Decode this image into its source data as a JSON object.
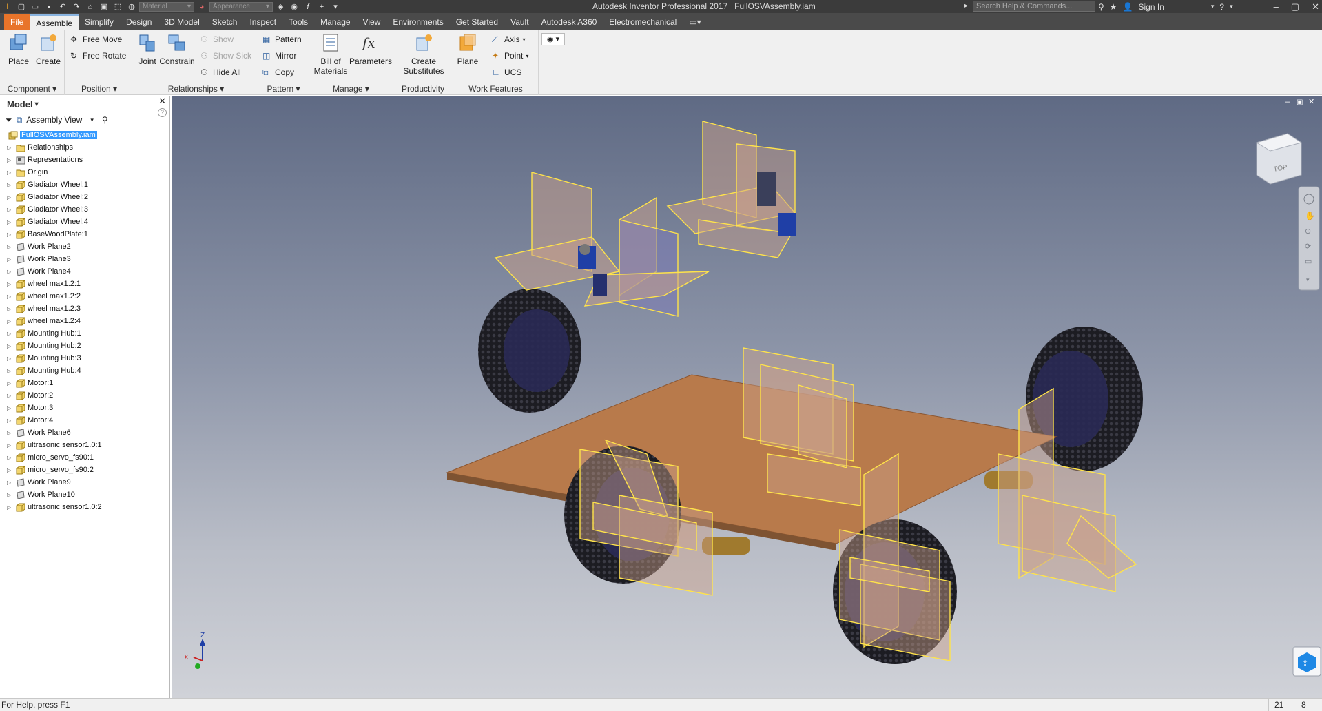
{
  "titlebar": {
    "app_title": "Autodesk Inventor Professional 2017",
    "file_title": "FullOSVAssembly.iam",
    "material_placeholder": "Material",
    "appearance_placeholder": "Appearance",
    "search_placeholder": "Search Help & Commands...",
    "sign_in": "Sign In"
  },
  "tabs": [
    "File",
    "Assemble",
    "Simplify",
    "Design",
    "3D Model",
    "Sketch",
    "Inspect",
    "Tools",
    "Manage",
    "View",
    "Environments",
    "Get Started",
    "Vault",
    "Autodesk A360",
    "Electromechanical"
  ],
  "ribbon": {
    "component": {
      "label": "Component",
      "place": "Place",
      "create": "Create"
    },
    "position": {
      "label": "Position",
      "free_move": "Free Move",
      "free_rotate": "Free Rotate"
    },
    "relationships": {
      "label": "Relationships",
      "joint": "Joint",
      "constrain": "Constrain",
      "show": "Show",
      "show_sick": "Show Sick",
      "hide_all": "Hide All"
    },
    "pattern": {
      "label": "Pattern",
      "pattern": "Pattern",
      "mirror": "Mirror",
      "copy": "Copy"
    },
    "manage": {
      "label": "Manage",
      "bom_line1": "Bill of",
      "bom_line2": "Materials",
      "parameters": "Parameters"
    },
    "productivity": {
      "label": "Productivity",
      "line1": "Create",
      "line2": "Substitutes"
    },
    "work_features": {
      "label": "Work Features",
      "plane": "Plane",
      "axis": "Axis",
      "point": "Point",
      "ucs": "UCS"
    }
  },
  "browser": {
    "title": "Model",
    "view": "Assembly View",
    "root": "FullOSVAssembly.iam",
    "items": [
      {
        "label": "Relationships",
        "icon": "folder-icon"
      },
      {
        "label": "Representations",
        "icon": "representations-icon"
      },
      {
        "label": "Origin",
        "icon": "folder-icon"
      },
      {
        "label": "Gladiator Wheel:1",
        "icon": "part-icon"
      },
      {
        "label": "Gladiator Wheel:2",
        "icon": "part-icon"
      },
      {
        "label": "Gladiator Wheel:3",
        "icon": "part-icon"
      },
      {
        "label": "Gladiator Wheel:4",
        "icon": "part-icon"
      },
      {
        "label": "BaseWoodPlate:1",
        "icon": "part-icon"
      },
      {
        "label": "Work Plane2",
        "icon": "work-plane-icon"
      },
      {
        "label": "Work Plane3",
        "icon": "work-plane-icon"
      },
      {
        "label": "Work Plane4",
        "icon": "work-plane-icon"
      },
      {
        "label": "wheel max1.2:1",
        "icon": "part-icon"
      },
      {
        "label": "wheel max1.2:2",
        "icon": "part-icon"
      },
      {
        "label": "wheel max1.2:3",
        "icon": "part-icon"
      },
      {
        "label": "wheel max1.2:4",
        "icon": "part-icon"
      },
      {
        "label": "Mounting Hub:1",
        "icon": "part-icon"
      },
      {
        "label": "Mounting Hub:2",
        "icon": "part-icon"
      },
      {
        "label": "Mounting Hub:3",
        "icon": "part-icon"
      },
      {
        "label": "Mounting Hub:4",
        "icon": "part-icon"
      },
      {
        "label": "Motor:1",
        "icon": "part-icon"
      },
      {
        "label": "Motor:2",
        "icon": "part-icon"
      },
      {
        "label": "Motor:3",
        "icon": "part-icon"
      },
      {
        "label": "Motor:4",
        "icon": "part-icon"
      },
      {
        "label": "Work Plane6",
        "icon": "work-plane-icon"
      },
      {
        "label": "ultrasonic sensor1.0:1",
        "icon": "part-icon"
      },
      {
        "label": "micro_servo_fs90:1",
        "icon": "part-icon"
      },
      {
        "label": "micro_servo_fs90:2",
        "icon": "part-icon"
      },
      {
        "label": "Work Plane9",
        "icon": "work-plane-icon"
      },
      {
        "label": "Work Plane10",
        "icon": "work-plane-icon"
      },
      {
        "label": "ultrasonic sensor1.0:2",
        "icon": "part-icon"
      }
    ]
  },
  "viewcube": {
    "face": "TOP"
  },
  "axis_triad": {
    "z": "Z",
    "x": "X"
  },
  "status": {
    "help": "For Help, press F1",
    "count1": "21",
    "count2": "8"
  },
  "colors": {
    "accent": "#e8742a",
    "selection": "#3399ff",
    "plate": "#b87a4b",
    "plane_edge": "#ffe34a"
  }
}
